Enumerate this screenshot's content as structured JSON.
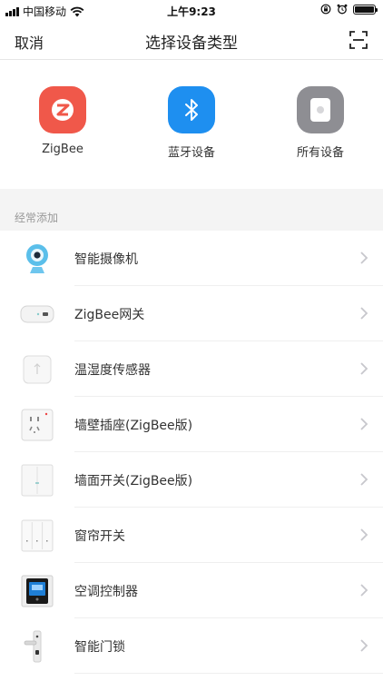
{
  "status_bar": {
    "carrier": "中国移动",
    "time": "上午9:23",
    "icons": [
      "signal-icon",
      "wifi-icon",
      "rotation-lock-icon",
      "alarm-icon",
      "battery-icon"
    ]
  },
  "nav": {
    "cancel_label": "取消",
    "title": "选择设备类型",
    "scan_icon": "scan-icon"
  },
  "device_types": [
    {
      "label": "ZigBee",
      "icon": "zigbee-icon",
      "color": "#f0584a"
    },
    {
      "label": "蓝牙设备",
      "icon": "bluetooth-icon",
      "color": "#1e8ff0"
    },
    {
      "label": "所有设备",
      "icon": "all-devices-icon",
      "color": "#8e8e93"
    }
  ],
  "frequent": {
    "header": "经常添加",
    "items": [
      {
        "label": "智能摄像机",
        "icon": "camera-icon"
      },
      {
        "label": "ZigBee网关",
        "icon": "gateway-icon"
      },
      {
        "label": "温湿度传感器",
        "icon": "temp-humidity-sensor-icon"
      },
      {
        "label": "墙壁插座(ZigBee版)",
        "icon": "wall-socket-icon"
      },
      {
        "label": "墙面开关(ZigBee版)",
        "icon": "wall-switch-icon"
      },
      {
        "label": "窗帘开关",
        "icon": "curtain-switch-icon"
      },
      {
        "label": "空调控制器",
        "icon": "ac-controller-icon"
      },
      {
        "label": "智能门锁",
        "icon": "door-lock-icon"
      }
    ]
  },
  "colors": {
    "divider": "#e6e6e6",
    "section_bg": "#f4f4f4",
    "chevron": "#c7c7cc"
  }
}
